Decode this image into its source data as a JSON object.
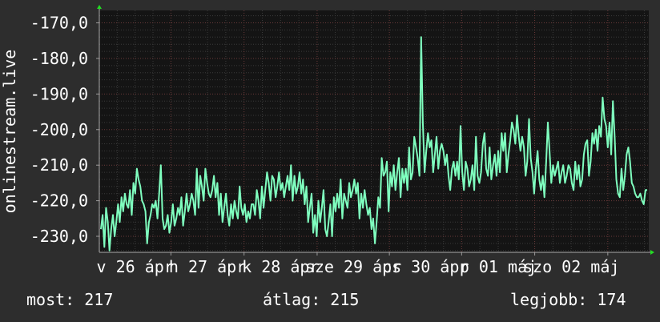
{
  "chart_data": {
    "type": "line",
    "ylabel": "onlinestream.live",
    "ylim": [
      -234.5,
      -166.5
    ],
    "y_ticks": [
      {
        "value": -170,
        "label": "-170,0"
      },
      {
        "value": -180,
        "label": "-180,0"
      },
      {
        "value": -190,
        "label": "-190,0"
      },
      {
        "value": -200,
        "label": "-200,0"
      },
      {
        "value": -210,
        "label": "-210,0"
      },
      {
        "value": -220,
        "label": "-220,0"
      },
      {
        "value": -230,
        "label": "-230,0"
      }
    ],
    "x_labels": [
      "v 26 ápr",
      "h 27 ápr",
      "k 28 ápr",
      "sze 29 ápr",
      "cs 30 ápr",
      "p 01 máj",
      "szo 02 máj"
    ],
    "day_boundaries": [
      0.0,
      0.1303,
      0.2634,
      0.3964,
      0.5279,
      0.6594,
      0.7924,
      0.9254
    ],
    "grid": true,
    "series": [
      {
        "name": "",
        "color": "#7fffbf",
        "values": [
          -228,
          -224,
          -233,
          -222,
          -226,
          -234,
          -228,
          -224,
          -230,
          -226,
          -221,
          -226,
          -219,
          -223,
          -218,
          -221,
          -222,
          -217,
          -224,
          -215,
          -218,
          -211,
          -214,
          -216,
          -220,
          -221,
          -223,
          -232,
          -226,
          -224,
          -221,
          -222,
          -220,
          -225,
          -218,
          -210,
          -225,
          -228,
          -227,
          -224,
          -229,
          -226,
          -221,
          -227,
          -225,
          -222,
          -224,
          -219,
          -227,
          -223,
          -218,
          -223,
          -221,
          -218,
          -220,
          -224,
          -211,
          -222,
          -213,
          -216,
          -220,
          -211,
          -215,
          -218,
          -219,
          -217,
          -213,
          -219,
          -215,
          -224,
          -218,
          -226,
          -222,
          -218,
          -224,
          -227,
          -221,
          -225,
          -220,
          -223,
          -225,
          -216,
          -222,
          -224,
          -221,
          -226,
          -223,
          -225,
          -221,
          -221,
          -224,
          -217,
          -220,
          -225,
          -216,
          -222,
          -217,
          -212,
          -215,
          -220,
          -213,
          -214,
          -219,
          -216,
          -212,
          -217,
          -215,
          -219,
          -216,
          -213,
          -217,
          -210,
          -220,
          -213,
          -218,
          -216,
          -212,
          -218,
          -214,
          -221,
          -216,
          -226,
          -222,
          -218,
          -229,
          -224,
          -230,
          -220,
          -226,
          -222,
          -217,
          -228,
          -230,
          -226,
          -221,
          -230,
          -219,
          -223,
          -218,
          -222,
          -214,
          -225,
          -218,
          -220,
          -222,
          -215,
          -219,
          -217,
          -214,
          -218,
          -215,
          -225,
          -218,
          -222,
          -217,
          -221,
          -224,
          -222,
          -228,
          -225,
          -232,
          -226,
          -219,
          -222,
          -208,
          -213,
          -212,
          -209,
          -223,
          -212,
          -216,
          -210,
          -217,
          -212,
          -208,
          -219,
          -211,
          -215,
          -211,
          -217,
          -205,
          -214,
          -212,
          -202,
          -205,
          -208,
          -213,
          -174,
          -198,
          -212,
          -206,
          -201,
          -205,
          -203,
          -212,
          -207,
          -202,
          -211,
          -206,
          -204,
          -206,
          -210,
          -207,
          -213,
          -217,
          -211,
          -209,
          -213,
          -209,
          -214,
          -199,
          -212,
          -217,
          -209,
          -211,
          -216,
          -214,
          -210,
          -217,
          -202,
          -213,
          -215,
          -212,
          -204,
          -201,
          -211,
          -213,
          -205,
          -214,
          -210,
          -207,
          -213,
          -206,
          -212,
          -201,
          -206,
          -201,
          -212,
          -207,
          -203,
          -198,
          -200,
          -204,
          -196,
          -202,
          -206,
          -202,
          -205,
          -213,
          -209,
          -197,
          -208,
          -212,
          -218,
          -211,
          -206,
          -214,
          -217,
          -213,
          -219,
          -209,
          -198,
          -206,
          -215,
          -210,
          -213,
          -211,
          -209,
          -215,
          -212,
          -210,
          -215,
          -213,
          -210,
          -211,
          -215,
          -217,
          -209,
          -214,
          -210,
          -216,
          -214,
          -207,
          -204,
          -203,
          -213,
          -209,
          -201,
          -204,
          -200,
          -206,
          -199,
          -202,
          -191,
          -197,
          -199,
          -205,
          -198,
          -207,
          -192,
          -202,
          -214,
          -218,
          -219,
          -211,
          -217,
          -213,
          -207,
          -205,
          -209,
          -215,
          -216,
          -218,
          -219,
          -219,
          -218,
          -220,
          -221,
          -217,
          -217
        ]
      }
    ]
  },
  "footer": {
    "now_label": "most: 217",
    "avg_label": "átlag: 215",
    "best_label": "legjobb: 174"
  }
}
